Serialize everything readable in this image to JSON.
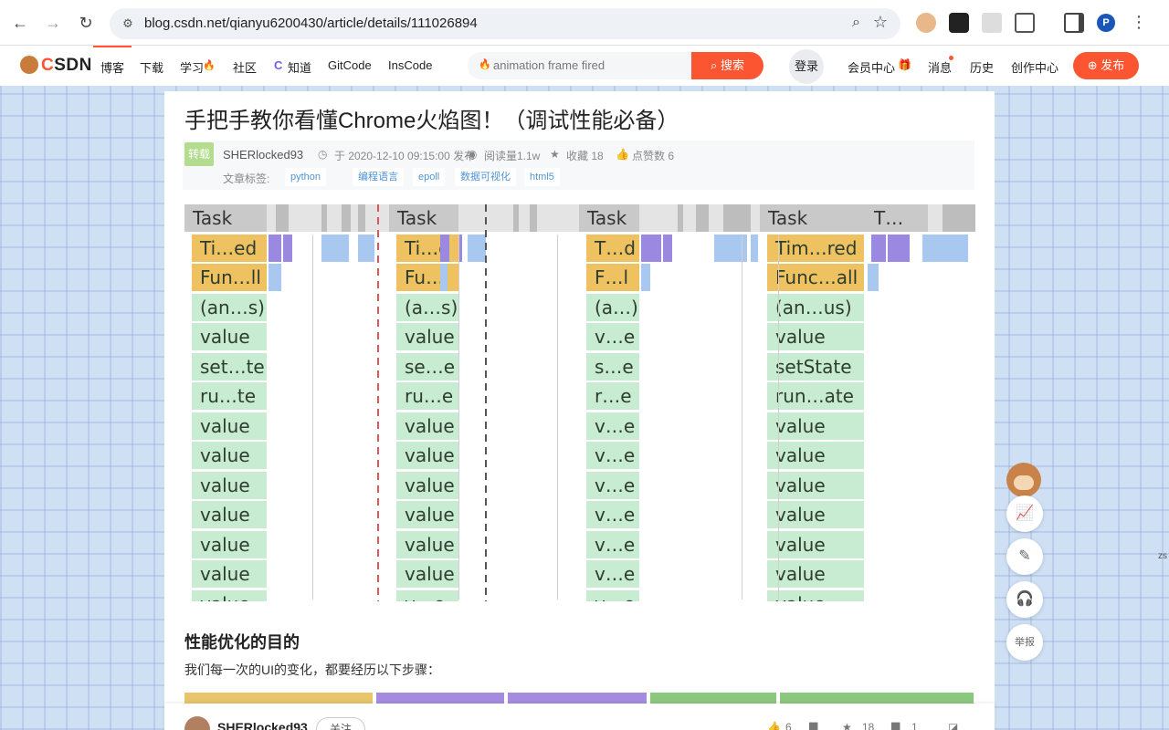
{
  "browser": {
    "url": "blog.csdn.net/qianyu6200430/article/details/111026894",
    "profile_initial": "P"
  },
  "toolbar": {
    "nav": [
      "博客",
      "下载",
      "学习",
      "社区",
      "知道",
      "GitCode",
      "InsCode"
    ],
    "search_placeholder": "animation frame fired",
    "search_button": "搜索",
    "login": "登录",
    "right_nav": [
      "会员中心",
      "消息",
      "历史",
      "创作中心"
    ],
    "publish": "发布",
    "accent_color": "#fc5531"
  },
  "article": {
    "title": "手把手教你看懂Chrome火焰图！（调试性能必备）",
    "badge": "转载",
    "author": "SHERlocked93",
    "publish_info": "于 2020-12-10 09:15:00 发布",
    "reads": "阅读量1.1w",
    "favorites": "收藏 18",
    "likes": "点赞数 6",
    "tags_label": "文章标签:",
    "tags": [
      "python",
      "编程语言",
      "epoll",
      "数据可视化",
      "html5"
    ],
    "section_heading": "性能优化的目的",
    "section_text": "我们每一次的UI的变化，都要经历以下步骤："
  },
  "flame_chart": {
    "columns": [
      [
        "Task",
        "Ti…ed",
        "Fun…ll",
        "(an…s)",
        "value",
        "set…te",
        "ru…te",
        "value",
        "value",
        "value",
        "value",
        "value",
        "value",
        "value"
      ],
      [
        "Task",
        "Ti…d",
        "Fu…l",
        "(a…s)",
        "value",
        "se…e",
        "ru…e",
        "value",
        "value",
        "value",
        "value",
        "value",
        "value",
        "v…e"
      ],
      [
        "Task",
        "T…d",
        "F…l",
        "(a…)",
        "v…e",
        "s…e",
        "r…e",
        "v…e",
        "v…e",
        "v…e",
        "v…e",
        "v…e",
        "v…e",
        "v…e"
      ],
      [
        "Task",
        "Tim…red",
        "Func…all",
        "(an…us)",
        "value",
        "setState",
        "run…ate",
        "value",
        "value",
        "value",
        "value",
        "value",
        "value",
        "value"
      ]
    ],
    "extra_task": "T…",
    "colors": {
      "task": "#c9c9c9",
      "timer": "#efc261",
      "function": "#c8ecd2",
      "purple": "#9b88e0",
      "blue": "#a9c8ef"
    }
  },
  "bottom_bar": {
    "author": "SHERlocked93",
    "follow": "关注",
    "likes": "6",
    "favorites": "18",
    "comments": "1"
  },
  "floating": {
    "report": "举报",
    "side_tab": "zs"
  }
}
